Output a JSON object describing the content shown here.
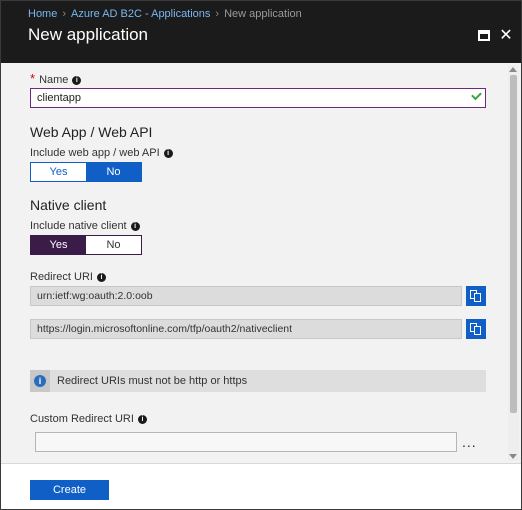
{
  "breadcrumb": {
    "items": [
      {
        "label": "Home"
      },
      {
        "label": "Azure AD B2C - Applications"
      },
      {
        "label": "New application"
      }
    ]
  },
  "blade": {
    "title": "New application",
    "maximize_icon": "maximize-icon",
    "close_icon": "close-icon"
  },
  "form": {
    "name": {
      "label": "Name",
      "required_marker": "*",
      "value": "clientapp"
    },
    "web": {
      "section_title": "Web App / Web API",
      "label": "Include web app / web API",
      "yes": "Yes",
      "no": "No",
      "selected": "No"
    },
    "native": {
      "section_title": "Native client",
      "label": "Include native client",
      "yes": "Yes",
      "no": "No",
      "selected": "Yes"
    },
    "redirect": {
      "label": "Redirect URI",
      "uris": [
        "urn:ietf:wg:oauth:2.0:oob",
        "https://login.microsoftonline.com/tfp/oauth2/nativeclient"
      ]
    },
    "notice": {
      "text": "Redirect URIs must not be http or https",
      "icon": "i"
    },
    "custom_redirect": {
      "label": "Custom Redirect URI",
      "value": "",
      "more": "..."
    }
  },
  "footer": {
    "create_label": "Create"
  },
  "colors": {
    "accent": "#0f5fc7",
    "native_selected": "#3b1b48",
    "valid_border": "#6c2b7f",
    "check": "#3aa447",
    "header_bg": "#1b1b1b"
  }
}
